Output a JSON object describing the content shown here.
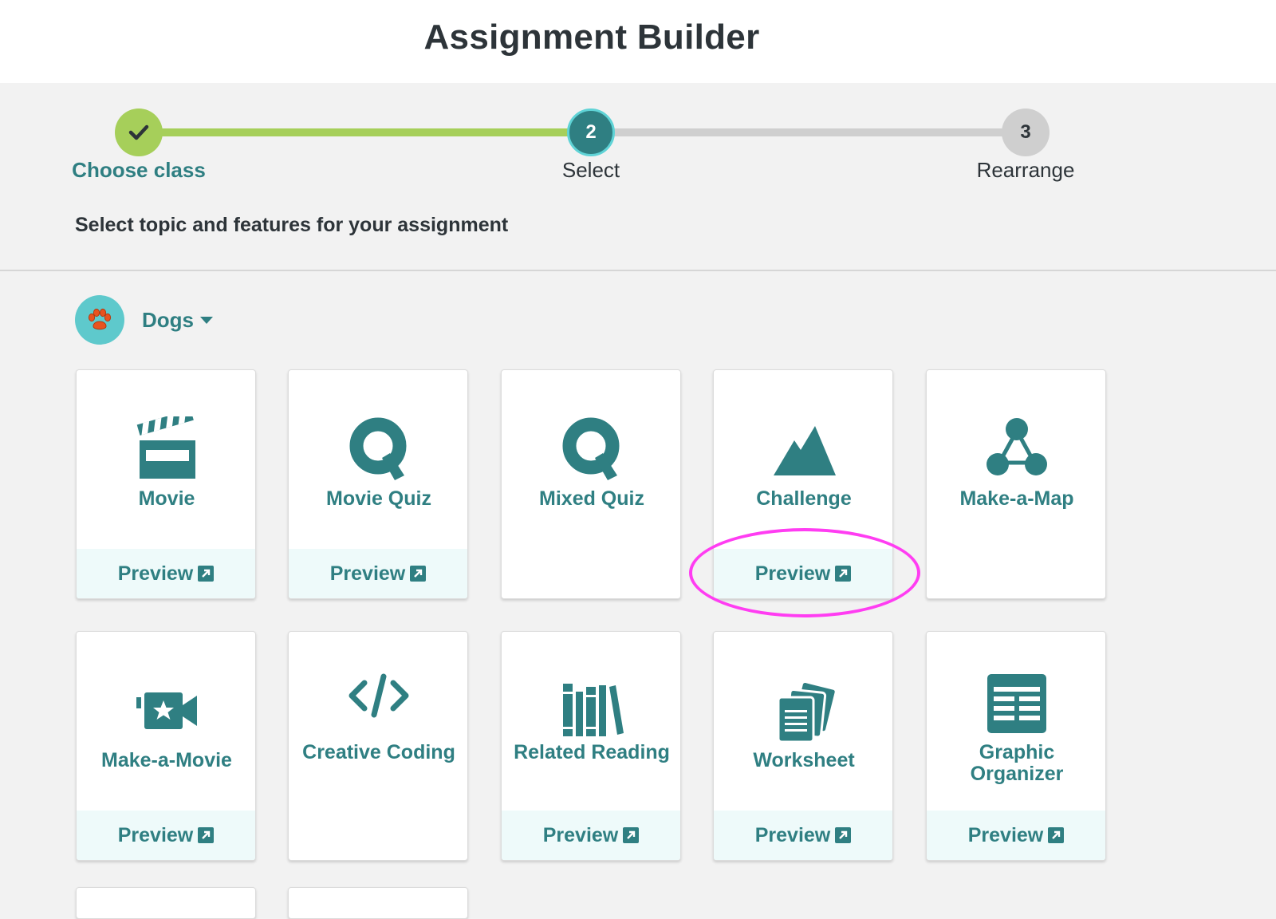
{
  "header": {
    "title": "Assignment Builder"
  },
  "stepper": {
    "steps": [
      {
        "number": "",
        "label": "Choose class",
        "state": "complete"
      },
      {
        "number": "2",
        "label": "Select",
        "state": "current"
      },
      {
        "number": "3",
        "label": "Rearrange",
        "state": "upcoming"
      }
    ]
  },
  "instruction": "Select topic and features for your assignment",
  "topic": {
    "name": "Dogs",
    "icon": "paw-icon"
  },
  "colors": {
    "accent": "#2f7f82",
    "complete": "#a6cf5a",
    "highlight": "#ff3df2"
  },
  "cards": [
    {
      "title": "Movie",
      "icon": "clapperboard-icon",
      "preview": "Preview"
    },
    {
      "title": "Movie Quiz",
      "icon": "quiz-q-icon",
      "preview": "Preview"
    },
    {
      "title": "Mixed Quiz",
      "icon": "quiz-q-icon",
      "preview": ""
    },
    {
      "title": "Challenge",
      "icon": "mountain-icon",
      "preview": "Preview"
    },
    {
      "title": "Make-a-Map",
      "icon": "concept-map-icon",
      "preview": ""
    },
    {
      "title": "Make-a-Movie",
      "icon": "video-camera-icon",
      "preview": "Preview"
    },
    {
      "title": "Creative Coding",
      "icon": "code-icon",
      "preview": ""
    },
    {
      "title": "Related Reading",
      "icon": "books-icon",
      "preview": "Preview"
    },
    {
      "title": "Worksheet",
      "icon": "worksheet-icon",
      "preview": "Preview"
    },
    {
      "title": "Graphic Organizer",
      "icon": "graphic-organizer-icon",
      "preview": "Preview"
    }
  ]
}
